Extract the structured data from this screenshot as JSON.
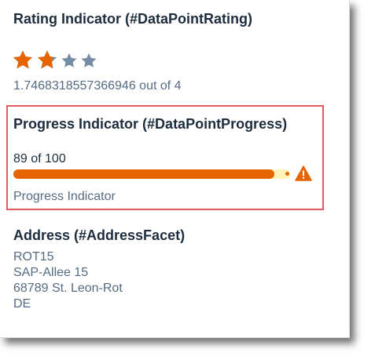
{
  "rating": {
    "title": "Rating Indicator (#DataPointRating)",
    "value": 1.7468318557366946,
    "max": 4,
    "summary": "1.7468318557366946 out of 4",
    "filled_color": "#e76500",
    "empty_color": "#758ca4",
    "star_icon": "star-icon"
  },
  "progress": {
    "title": "Progress Indicator (#DataPointProgress)",
    "value_text": "89 of 100",
    "value": 89,
    "max": 100,
    "label": "Progress Indicator",
    "bar_color": "#e76500",
    "track_color": "#fff3b8",
    "status_icon": "warning-icon",
    "status_color": "#e76500",
    "highlight_color": "#e05a5f"
  },
  "address": {
    "title": "Address (#AddressFacet)",
    "lines": [
      "ROT15",
      "SAP-Allee 15",
      "68789 St. Leon-Rot",
      "DE"
    ]
  }
}
